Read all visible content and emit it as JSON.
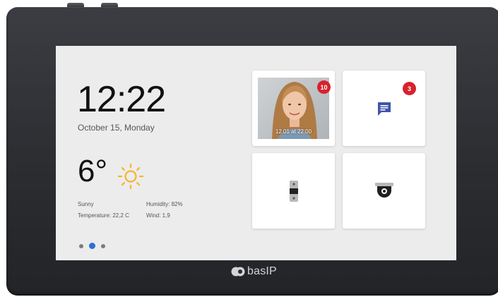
{
  "clock": {
    "time": "12:22",
    "date": "October 15, Monday"
  },
  "weather": {
    "temperature": "6°",
    "condition": "Sunny",
    "details_temperature": "Temperature: 22,2 C",
    "humidity": "Humidity: 82%",
    "wind": "Wind: 1,9",
    "icon": "sun-icon"
  },
  "pagination": {
    "pages": 3,
    "active_page": 2
  },
  "tiles": {
    "visitor_photo": {
      "badge": "10",
      "caption": "12.01 at 22:00"
    },
    "messages": {
      "badge": "3",
      "icon": "message-icon"
    },
    "door_lock": {
      "icon": "door-lock-icon"
    },
    "camera": {
      "icon": "dome-camera-icon"
    }
  },
  "brand": {
    "logo_text": "basIP"
  },
  "colors": {
    "accent": "#2f6fd6",
    "badge": "#d7222d",
    "sun": "#f5b52a",
    "message_icon": "#3f55a8"
  }
}
